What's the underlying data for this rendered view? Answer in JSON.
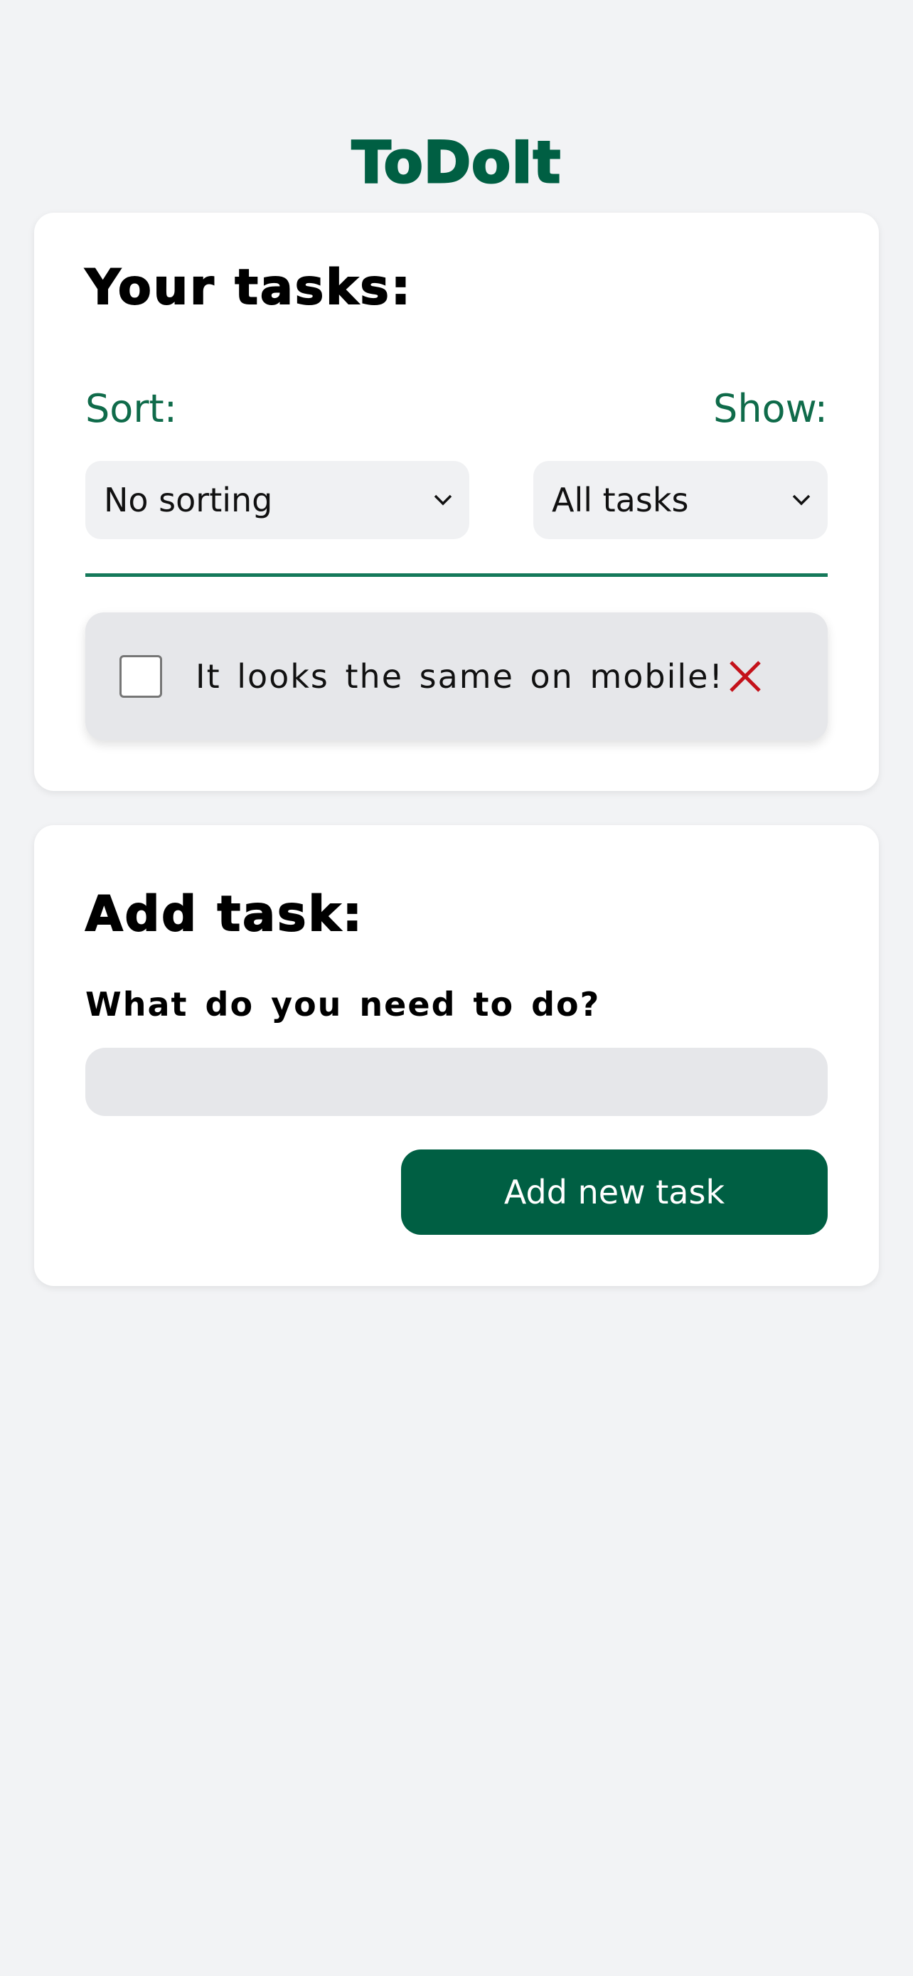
{
  "app": {
    "title": "ToDoIt"
  },
  "tasks_panel": {
    "heading": "Your tasks:",
    "sort": {
      "label": "Sort:",
      "selected": "No sorting"
    },
    "show": {
      "label": "Show:",
      "selected": "All tasks"
    },
    "items": [
      {
        "text": "It looks the same on mobile!",
        "completed": false
      }
    ]
  },
  "add_panel": {
    "heading": "Add task:",
    "input_label": "What do you need to do?",
    "input_value": "",
    "button_label": "Add new task"
  },
  "colors": {
    "brand": "#005f43",
    "accent_label": "#0f6b4a",
    "divider": "#15795a",
    "delete": "#c4121a",
    "background": "#f2f3f5"
  },
  "icons": {
    "select_chevron": "chevron-down-icon",
    "delete_task": "close-icon"
  }
}
